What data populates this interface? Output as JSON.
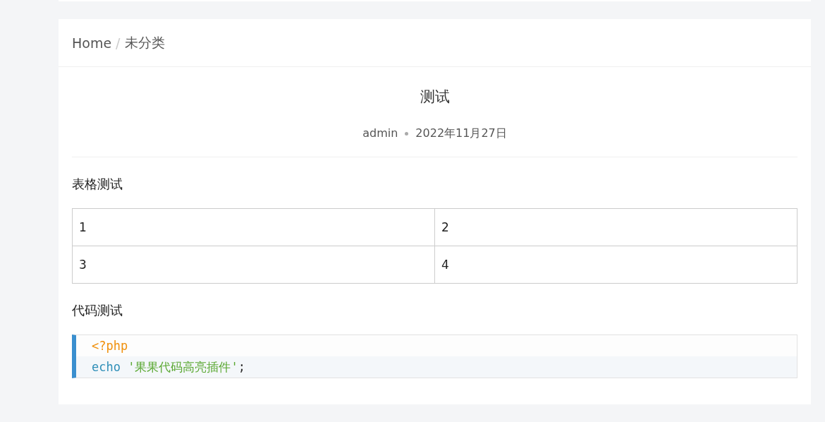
{
  "breadcrumb": [
    {
      "label": "Home"
    },
    {
      "label": "未分类"
    }
  ],
  "breadcrumb_separator": "/",
  "post": {
    "title": "测试",
    "author": "admin",
    "date": "2022年11月27日"
  },
  "content": [
    {
      "kind": "heading",
      "text": "表格测试"
    },
    {
      "kind": "table",
      "rows": [
        [
          "1",
          "2"
        ],
        [
          "3",
          "4"
        ]
      ]
    },
    {
      "kind": "heading",
      "text": "代码测试"
    },
    {
      "kind": "code",
      "lines": [
        [
          {
            "kind": "tag",
            "text": "<?php"
          }
        ],
        [
          {
            "kind": "keyword",
            "text": "echo"
          },
          {
            "kind": "string",
            "text": "'果果代码高亮插件'"
          },
          {
            "kind": "punct",
            "text": ";"
          }
        ]
      ]
    }
  ]
}
